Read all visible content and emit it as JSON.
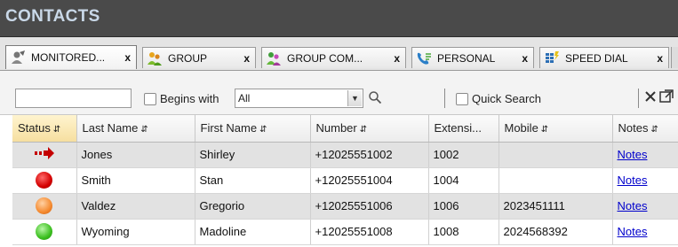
{
  "panel": {
    "title": "CONTACTS"
  },
  "tabs": [
    {
      "label": "MONITORED...",
      "close": "x",
      "icon": "user-pin-icon"
    },
    {
      "label": "GROUP",
      "close": "x",
      "icon": "group-icon"
    },
    {
      "label": "GROUP COM...",
      "close": "x",
      "icon": "group-common-icon"
    },
    {
      "label": "PERSONAL",
      "close": "x",
      "icon": "personal-phonebook-icon"
    },
    {
      "label": "SPEED DIAL",
      "close": "x",
      "icon": "speed-dial-icon"
    }
  ],
  "toolbar": {
    "search_value": "",
    "begins_with_label": "Begins with",
    "filter_selected": "All",
    "quick_search_label": "Quick Search"
  },
  "table": {
    "columns": [
      "Status",
      "Last Name",
      "First Name",
      "Number",
      "Extensi...",
      "Mobile",
      "Notes"
    ],
    "sorted_column": "Status",
    "rows": [
      {
        "status": "forward-arrow-icon",
        "last": "Jones",
        "first": "Shirley",
        "number": "+12025551002",
        "ext": "1002",
        "mobile": "",
        "notes": "Notes"
      },
      {
        "status": "red",
        "last": "Smith",
        "first": "Stan",
        "number": "+12025551004",
        "ext": "1004",
        "mobile": "",
        "notes": "Notes"
      },
      {
        "status": "orange",
        "last": "Valdez",
        "first": "Gregorio",
        "number": "+12025551006",
        "ext": "1006",
        "mobile": "2023451111",
        "notes": "Notes"
      },
      {
        "status": "green",
        "last": "Wyoming",
        "first": "Madoline",
        "number": "+12025551008",
        "ext": "1008",
        "mobile": "2024568392",
        "notes": "Notes"
      }
    ]
  },
  "colors": {
    "title_bar": "#4a4a4a",
    "title_text": "#c9d8e8",
    "link": "#0000cc",
    "sorted_header": "#f6dfa0"
  }
}
